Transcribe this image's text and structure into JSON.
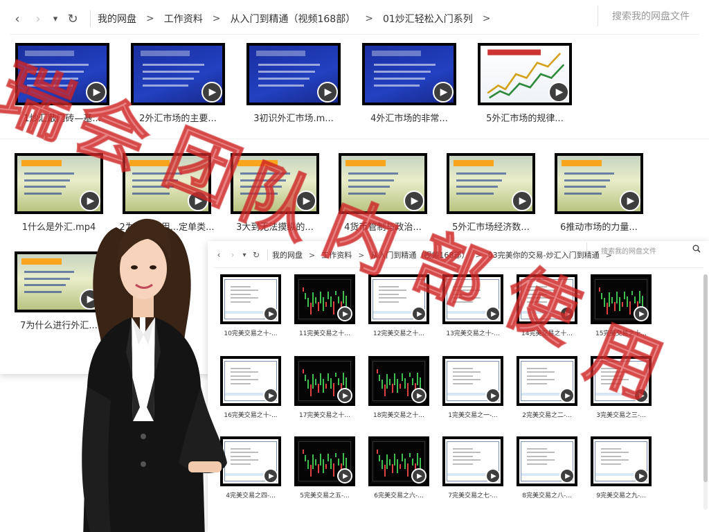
{
  "window_main": {
    "nav": {
      "back": "‹",
      "forward": "›",
      "dropdown": "▾",
      "refresh": "↻"
    },
    "breadcrumbs": [
      "我的网盘",
      "工作资料",
      "从入门到精通（视频168部）",
      "01炒汇轻松入门系列"
    ],
    "breadcrumb_sep": ">",
    "search_placeholder": "搜索我的网盘文件",
    "row1": [
      {
        "label": "1炒汇敲门砖—基...",
        "thumb": "blue"
      },
      {
        "label": "2外汇市场的主要...",
        "thumb": "blue"
      },
      {
        "label": "3初识外汇市场.m...",
        "thumb": "blue"
      },
      {
        "label": "4外汇市场的非常...",
        "thumb": "blue"
      },
      {
        "label": "5外汇市场的规律...",
        "thumb": "chart"
      }
    ],
    "row2": [
      {
        "label": "1什么是外汇.mp4",
        "thumb": "field"
      },
      {
        "label": "2为什么使用...定单类...",
        "thumb": "field"
      },
      {
        "label": "3大到无法摸纵的...",
        "thumb": "field"
      },
      {
        "label": "4货币管制与政治...",
        "thumb": "field"
      },
      {
        "label": "5外汇市场经济数...",
        "thumb": "field"
      },
      {
        "label": "6推动市场的力量...",
        "thumb": "field"
      }
    ],
    "row3": [
      {
        "label": "7为什么进行外汇...",
        "thumb": "field"
      }
    ]
  },
  "window_second": {
    "nav": {
      "back": "‹",
      "forward": "›",
      "dropdown": "▾",
      "refresh": "↻"
    },
    "breadcrumbs": [
      "我的网盘",
      "工作资料",
      "从入门到精通（视频168部）",
      "03完美你的交易-炒汇入门到精通"
    ],
    "breadcrumb_sep": ">",
    "search_placeholder": "搜索我的网盘文件",
    "search_icon": "search-icon",
    "row1": [
      {
        "label": "10完美交易之十-...",
        "thumb": "trade"
      },
      {
        "label": "11完美交易之十...",
        "thumb": "dark"
      },
      {
        "label": "12完美交易之十...",
        "thumb": "trade"
      },
      {
        "label": "13完美交易之十-...",
        "thumb": "trade"
      },
      {
        "label": "14完美交易之十...",
        "thumb": "trade"
      },
      {
        "label": "15完美交易之十...",
        "thumb": "dark"
      }
    ],
    "row2": [
      {
        "label": "16完美交易之十-...",
        "thumb": "trade"
      },
      {
        "label": "17完美交易之十...",
        "thumb": "dark"
      },
      {
        "label": "18完美交易之十...",
        "thumb": "dark"
      },
      {
        "label": "1完美交易之一-...",
        "thumb": "trade"
      },
      {
        "label": "2完美交易之二-...",
        "thumb": "trade"
      },
      {
        "label": "3完美交易之三-...",
        "thumb": "trade"
      }
    ],
    "row3": [
      {
        "label": "4完美交易之四-...",
        "thumb": "trade"
      },
      {
        "label": "5完美交易之五-...",
        "thumb": "dark"
      },
      {
        "label": "6完美交易之六-...",
        "thumb": "dark"
      },
      {
        "label": "7完美交易之七-...",
        "thumb": "trade"
      },
      {
        "label": "8完美交易之八-...",
        "thumb": "trade"
      },
      {
        "label": "9完美交易之九-...",
        "thumb": "trade"
      }
    ]
  },
  "watermark": {
    "text": "瑞会团队内部使用",
    "color": "#da3737"
  },
  "colors": {
    "play_button": "#3e3e3e",
    "thumb_border": "#000000",
    "slide_blue": "#2240c0"
  }
}
